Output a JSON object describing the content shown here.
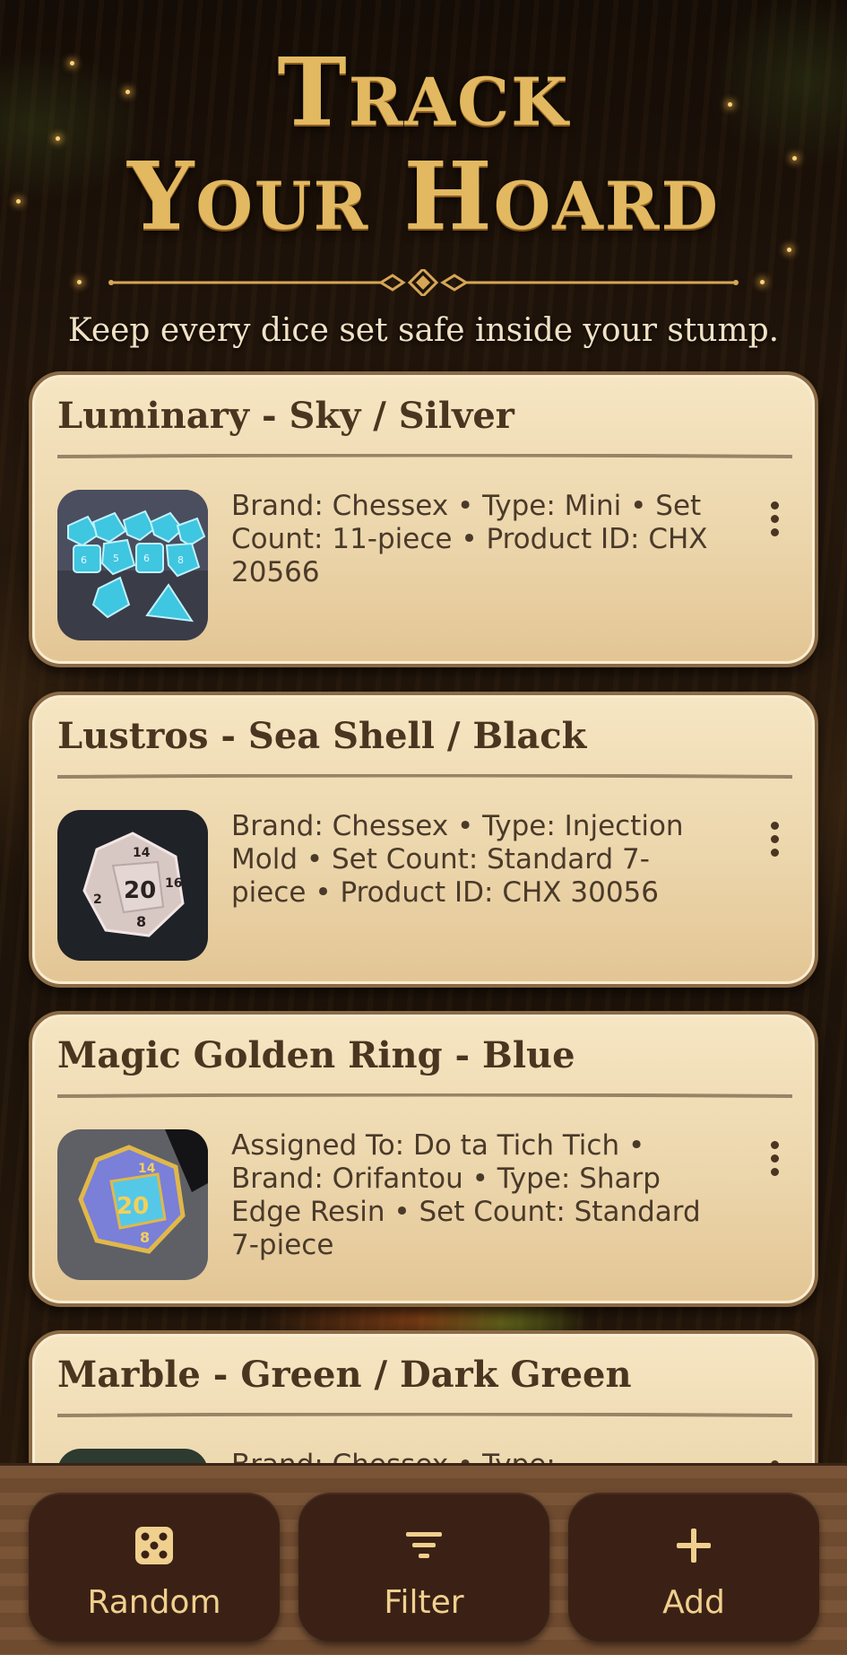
{
  "header": {
    "title_line1": "Track",
    "title_line2": "Your Hoard",
    "subtitle": "Keep every dice set safe inside your stump."
  },
  "colors": {
    "gold": "#e2b861",
    "card_bg": "#f0dcb4",
    "card_text": "#4a3520",
    "nav_button": "#3b2115",
    "nav_label": "#f0d08e"
  },
  "dice_sets": [
    {
      "title": "Luminary - Sky / Silver",
      "description": "Brand: Chessex • Type: Mini • Set Count: 11-piece • Product ID: CHX 20566",
      "thumb": "cyan-translucent-dice"
    },
    {
      "title": "Lustros - Sea Shell / Black",
      "description": "Brand: Chessex • Type: Injection Mold • Set Count: Standard 7-piece • Product ID: CHX 30056",
      "thumb": "pearl-d20"
    },
    {
      "title": "Magic Golden Ring - Blue",
      "description": "Assigned To: Do ta Tich Tich • Brand: Orifantou • Type: Sharp Edge Resin • Set Count: Standard 7-piece",
      "thumb": "blue-resin-d20"
    },
    {
      "title": "Marble - Green / Dark Green",
      "description": "Brand: Chessex • Type:",
      "thumb": "green-marble-dice"
    }
  ],
  "nav": {
    "random_label": "Random",
    "filter_label": "Filter",
    "add_label": "Add"
  }
}
